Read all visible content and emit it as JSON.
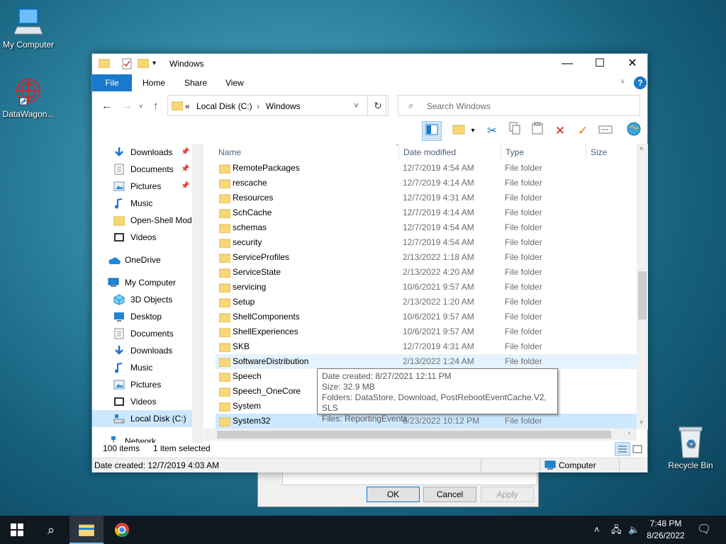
{
  "desktop": {
    "icons": [
      {
        "label": "My Computer"
      },
      {
        "label": "DataWagon..."
      },
      {
        "label": "Recycle Bin"
      }
    ]
  },
  "window": {
    "title": "Windows",
    "ribbon_tabs": [
      "File",
      "Home",
      "Share",
      "View"
    ],
    "address": {
      "overflow": "«",
      "crumbs": [
        "Local Disk (C:)",
        "Windows"
      ]
    },
    "search_placeholder": "Search Windows"
  },
  "navpane": {
    "items": [
      {
        "label": "Downloads",
        "icon": "download-arrow-icon",
        "pinned": true
      },
      {
        "label": "Documents",
        "icon": "document-icon",
        "pinned": true
      },
      {
        "label": "Pictures",
        "icon": "pictures-icon",
        "pinned": true
      },
      {
        "label": "Music",
        "icon": "music-note-icon",
        "pinned": false
      },
      {
        "label": "Open-Shell Mod",
        "icon": "folder-icon",
        "pinned": false
      },
      {
        "label": "Videos",
        "icon": "video-icon",
        "pinned": false
      },
      {
        "label": "OneDrive",
        "icon": "cloud-icon",
        "pinned": false
      },
      {
        "label": "My Computer",
        "icon": "computer-icon",
        "pinned": false
      },
      {
        "label": "3D Objects",
        "icon": "cube-icon",
        "pinned": false
      },
      {
        "label": "Desktop",
        "icon": "desktop-icon",
        "pinned": false
      },
      {
        "label": "Documents",
        "icon": "document-icon",
        "pinned": false
      },
      {
        "label": "Downloads",
        "icon": "download-arrow-icon",
        "pinned": false
      },
      {
        "label": "Music",
        "icon": "music-note-icon",
        "pinned": false
      },
      {
        "label": "Pictures",
        "icon": "pictures-icon",
        "pinned": false
      },
      {
        "label": "Videos",
        "icon": "video-icon",
        "pinned": false
      },
      {
        "label": "Local Disk (C:)",
        "icon": "drive-icon",
        "pinned": false
      },
      {
        "label": "Network",
        "icon": "network-icon",
        "pinned": false
      }
    ]
  },
  "columns": {
    "name": "Name",
    "date": "Date modified",
    "type": "Type",
    "size": "Size"
  },
  "files": [
    {
      "name": "RemotePackages",
      "date": "12/7/2019 4:54 AM",
      "type": "File folder"
    },
    {
      "name": "rescache",
      "date": "12/7/2019 4:14 AM",
      "type": "File folder"
    },
    {
      "name": "Resources",
      "date": "12/7/2019 4:31 AM",
      "type": "File folder"
    },
    {
      "name": "SchCache",
      "date": "12/7/2019 4:14 AM",
      "type": "File folder"
    },
    {
      "name": "schemas",
      "date": "12/7/2019 4:54 AM",
      "type": "File folder"
    },
    {
      "name": "security",
      "date": "12/7/2019 4:54 AM",
      "type": "File folder"
    },
    {
      "name": "ServiceProfiles",
      "date": "2/13/2022 1:18 AM",
      "type": "File folder"
    },
    {
      "name": "ServiceState",
      "date": "2/13/2022 4:20 AM",
      "type": "File folder"
    },
    {
      "name": "servicing",
      "date": "10/6/2021 9:57 AM",
      "type": "File folder"
    },
    {
      "name": "Setup",
      "date": "2/13/2022 1:20 AM",
      "type": "File folder"
    },
    {
      "name": "ShellComponents",
      "date": "10/6/2021 9:57 AM",
      "type": "File folder"
    },
    {
      "name": "ShellExperiences",
      "date": "10/6/2021 9:57 AM",
      "type": "File folder"
    },
    {
      "name": "SKB",
      "date": "12/7/2019 4:31 AM",
      "type": "File folder"
    },
    {
      "name": "SoftwareDistribution",
      "date": "2/13/2022 1:24 AM",
      "type": "File folder"
    },
    {
      "name": "Speech",
      "date": "",
      "type": ""
    },
    {
      "name": "Speech_OneCore",
      "date": "",
      "type": ""
    },
    {
      "name": "System",
      "date": "",
      "type": ""
    },
    {
      "name": "System32",
      "date": "6/23/2022 10:12 PM",
      "type": "File folder"
    }
  ],
  "tooltip": {
    "line1": "Date created: 8/27/2021 12:11 PM",
    "line2": "Size: 32.9 MB",
    "line3": "Folders: DataStore, Download, PostRebootEventCache.V2, SLS",
    "line4": "Files: ReportingEvents"
  },
  "status": {
    "count": "100 items",
    "selected": "1 item selected"
  },
  "details": {
    "created": "Date created: 12/7/2019 4:03 AM",
    "location": "Computer"
  },
  "dialog": {
    "ok": "OK",
    "cancel": "Cancel",
    "apply": "Apply"
  },
  "taskbar": {
    "time": "7:48 PM",
    "date": "8/26/2022"
  },
  "colors": {
    "accent": "#1979ca",
    "selection": "#cce8ff",
    "hover": "#e5f3ff",
    "folder": "#f8d775"
  }
}
